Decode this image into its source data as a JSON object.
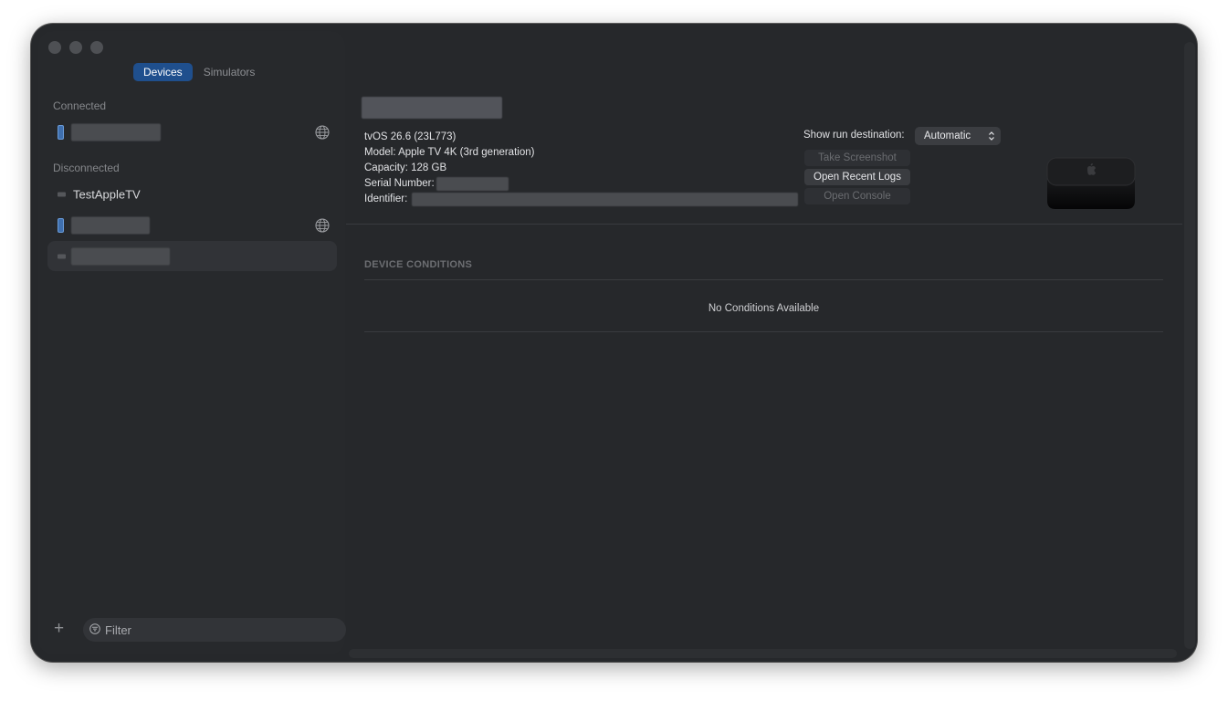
{
  "sidebar": {
    "tabs": [
      {
        "label": "Devices",
        "active": true
      },
      {
        "label": "Simulators",
        "active": false
      }
    ],
    "sections": {
      "connected": "Connected",
      "disconnected": "Disconnected"
    },
    "disconnected_device_name": "TestAppleTV",
    "filter": {
      "placeholder": "Filter"
    },
    "add_icon": "plus-icon"
  },
  "device": {
    "os": "tvOS 26.6 (23L773)",
    "model": "Model: Apple TV 4K (3rd generation)",
    "capacity": "Capacity: 128 GB",
    "serial_label": "Serial Number:",
    "identifier_label": "Identifier:",
    "image": "apple-tv-image"
  },
  "actions": {
    "show_run_destination_label": "Show run destination:",
    "run_destination_value": "Automatic",
    "take_screenshot": "Take Screenshot",
    "open_recent_logs": "Open Recent Logs",
    "open_console": "Open Console"
  },
  "conditions": {
    "title": "DEVICE CONDITIONS",
    "empty_message": "No Conditions Available"
  },
  "colors": {
    "accent": "#1f4f8d",
    "window_background": "#26282b"
  }
}
